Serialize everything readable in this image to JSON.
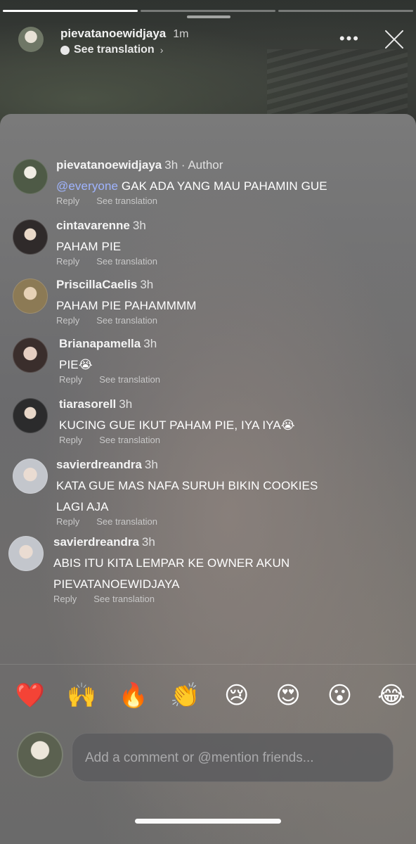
{
  "story": {
    "username": "pievatanoewidjaya",
    "time": "1m",
    "see_translation": "See translation",
    "progress": [
      1.0,
      0.0,
      0.0
    ]
  },
  "comments": [
    {
      "name": "pievatanoewidjaya",
      "meta": "3h · Author",
      "mention": "@everyone",
      "text": " GAK ADA YANG MAU PAHAMIN GUE",
      "reply": "Reply",
      "translate": "See translation"
    },
    {
      "name": "cintavarenne",
      "meta": "3h",
      "text": "PAHAM PIE",
      "reply": "Reply",
      "translate": "See translation"
    },
    {
      "name": "PriscillaCaelis",
      "meta": "3h",
      "text": "PAHAM PIE PAHAMMMM",
      "reply": "Reply",
      "translate": "See translation"
    },
    {
      "name": "Brianapamella",
      "meta": "3h",
      "text": "PIE😭",
      "reply": "Reply",
      "translate": "See translation"
    },
    {
      "name": "tiarasorell",
      "meta": "3h",
      "text": "KUCING GUE IKUT PAHAM PIE, IYA IYA😭",
      "reply": "Reply",
      "translate": "See translation"
    },
    {
      "name": "savierdreandra",
      "meta": "3h",
      "text_line1": "KATA GUE MAS NAFA SURUH BIKIN COOKIES",
      "text_line2": "LAGI AJA",
      "reply": "Reply",
      "translate": "See translation"
    },
    {
      "name": "savierdreandra",
      "meta": "3h",
      "text_line1": "ABIS ITU KITA LEMPAR KE OWNER AKUN",
      "text_line2": "PIEVATANOEWIDJAYA",
      "reply": "Reply",
      "translate": "See translation"
    }
  ],
  "reactions": [
    "❤️",
    "🙌",
    "🔥",
    "👏",
    "😢",
    "😍",
    "😮",
    "😂"
  ],
  "composer": {
    "placeholder": "Add a comment or @mention friends..."
  }
}
